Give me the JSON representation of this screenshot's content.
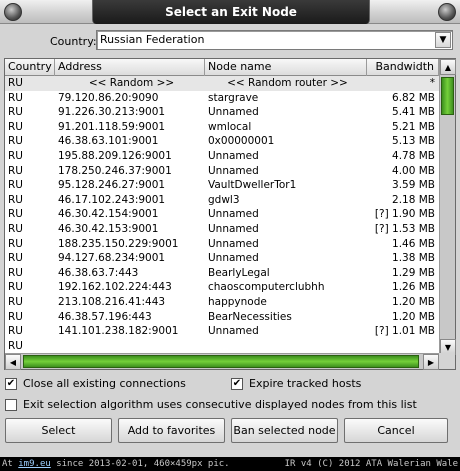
{
  "window": {
    "title": "Select an Exit Node"
  },
  "country": {
    "label": "Country:",
    "selected": "Russian Federation"
  },
  "table": {
    "columns": [
      "Country",
      "Address",
      "Node name",
      "Bandwidth"
    ],
    "rows": [
      {
        "country": "RU",
        "address": "<< Random >>",
        "name": "<< Random router >>",
        "bandwidth": "*"
      },
      {
        "country": "RU",
        "address": "79.120.86.20:9090",
        "name": "stargrave",
        "bandwidth": "6.82 MB"
      },
      {
        "country": "RU",
        "address": "91.226.30.213:9001",
        "name": "Unnamed",
        "bandwidth": "5.41 MB"
      },
      {
        "country": "RU",
        "address": "91.201.118.59:9001",
        "name": "wmlocal",
        "bandwidth": "5.21 MB"
      },
      {
        "country": "RU",
        "address": "46.38.63.101:9001",
        "name": "0x00000001",
        "bandwidth": "5.13 MB"
      },
      {
        "country": "RU",
        "address": "195.88.209.126:9001",
        "name": "Unnamed",
        "bandwidth": "4.78 MB"
      },
      {
        "country": "RU",
        "address": "178.250.246.37:9001",
        "name": "Unnamed",
        "bandwidth": "4.00 MB"
      },
      {
        "country": "RU",
        "address": "95.128.246.27:9001",
        "name": "VaultDwellerTor1",
        "bandwidth": "3.59 MB"
      },
      {
        "country": "RU",
        "address": "46.17.102.243:9001",
        "name": "gdwl3",
        "bandwidth": "2.18 MB"
      },
      {
        "country": "RU",
        "address": "46.30.42.154:9001",
        "name": "Unnamed",
        "bandwidth": "[?] 1.90 MB"
      },
      {
        "country": "RU",
        "address": "46.30.42.153:9001",
        "name": "Unnamed",
        "bandwidth": "[?] 1.53 MB"
      },
      {
        "country": "RU",
        "address": "188.235.150.229:9001",
        "name": "Unnamed",
        "bandwidth": "1.46 MB"
      },
      {
        "country": "RU",
        "address": "94.127.68.234:9001",
        "name": "Unnamed",
        "bandwidth": "1.38 MB"
      },
      {
        "country": "RU",
        "address": "46.38.63.7:443",
        "name": "BearlyLegal",
        "bandwidth": "1.29 MB"
      },
      {
        "country": "RU",
        "address": "192.162.102.224:443",
        "name": "chaoscomputerclubhh",
        "bandwidth": "1.26 MB"
      },
      {
        "country": "RU",
        "address": "213.108.216.41:443",
        "name": "happynode",
        "bandwidth": "1.20 MB"
      },
      {
        "country": "RU",
        "address": "46.38.57.196:443",
        "name": "BearNecessities",
        "bandwidth": "1.20 MB"
      },
      {
        "country": "RU",
        "address": "141.101.238.182:9001",
        "name": "Unnamed",
        "bandwidth": "[?] 1.01 MB"
      },
      {
        "country": "RU",
        "address": "",
        "name": "",
        "bandwidth": ""
      }
    ]
  },
  "options": {
    "close_connections": {
      "label": "Close all existing connections",
      "checked": true
    },
    "expire_hosts": {
      "label": "Expire tracked hosts",
      "checked": true
    },
    "consecutive": {
      "label": "Exit selection algorithm uses consecutive displayed nodes from this list",
      "checked": false
    }
  },
  "buttons": {
    "select": "Select",
    "favorites": "Add to favorites",
    "ban": "Ban selected node",
    "cancel": "Cancel"
  },
  "footer": {
    "prefix": "At ",
    "link": "im9.eu",
    "text": " since 2013-02-01, 460×459px pic.",
    "right": "IR v4 (C) 2012 ATA Walerian Wale"
  },
  "icons": {
    "check": "✔",
    "arrow_down": "▼",
    "arrow_up": "▲",
    "arrow_left": "◀",
    "arrow_right": "▶"
  },
  "colors": {
    "title_plate": "#1a1a1a",
    "scroll_thumb": "#74d03a",
    "selected_row": "#e6e6e6"
  }
}
